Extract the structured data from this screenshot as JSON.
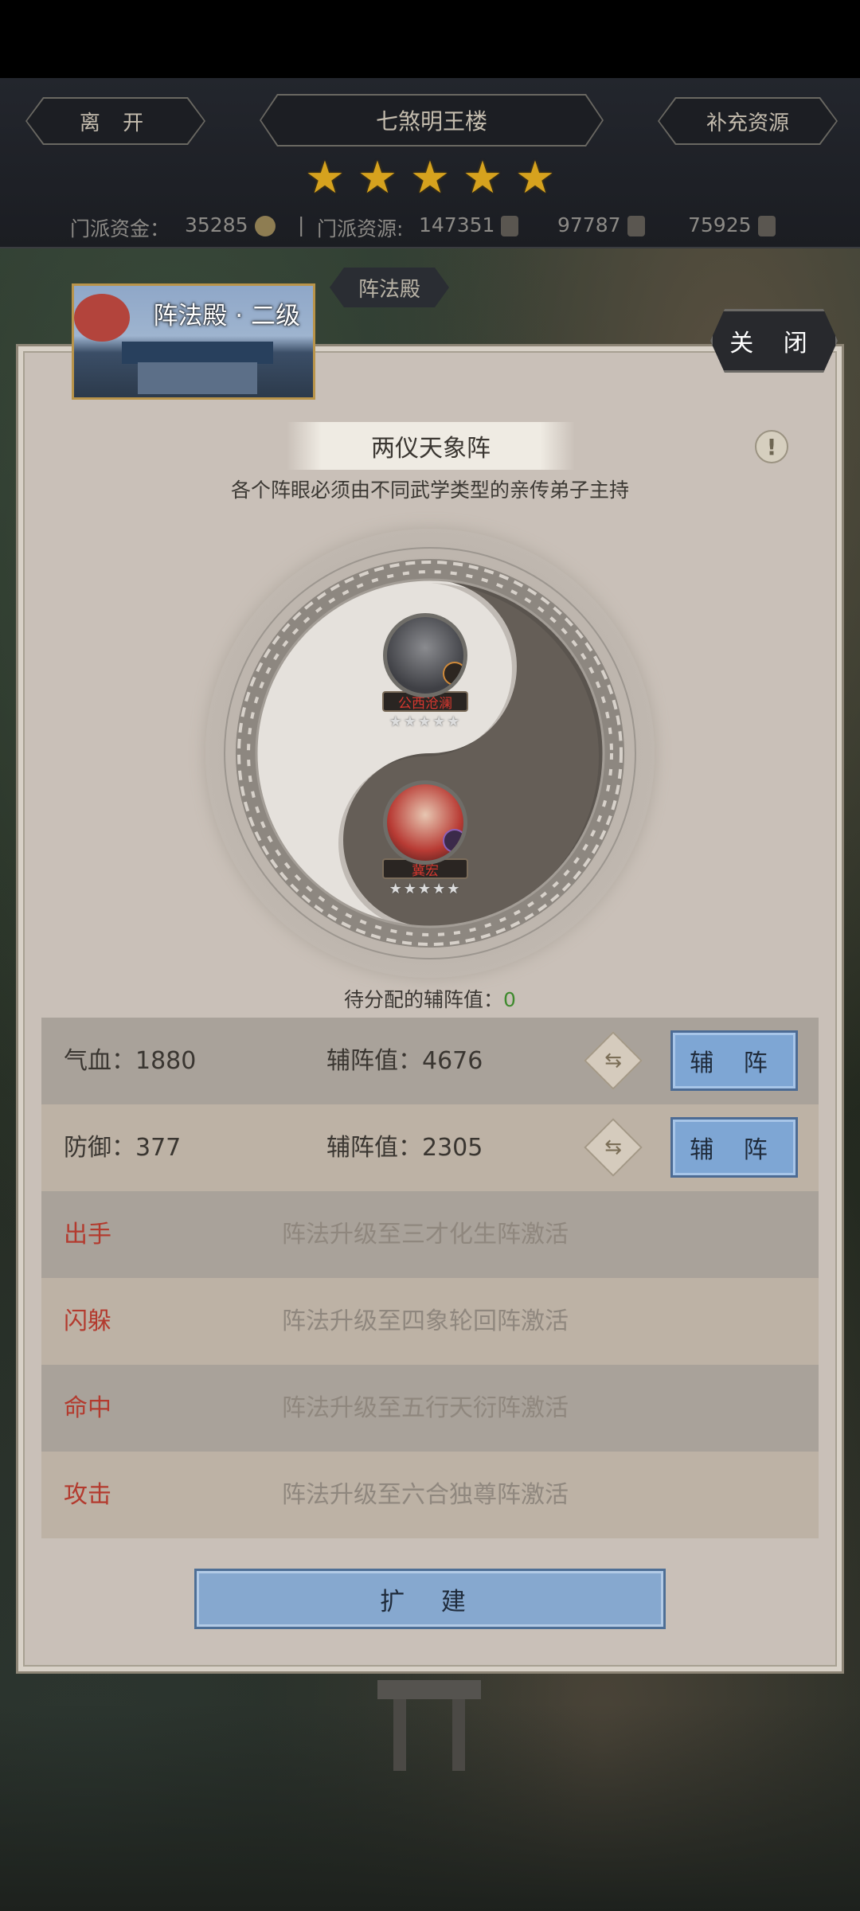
{
  "header": {
    "leave_label": "离 开",
    "location_title": "七煞明王楼",
    "replenish_label": "补充资源",
    "stars": [
      "★",
      "★",
      "★",
      "★",
      "★"
    ],
    "resources": {
      "funds_label": "门派资金：",
      "funds_value": "35285",
      "separator": "|",
      "resource_label": "门派资源:",
      "resource_value": "147351",
      "res2_value": "97787",
      "res3_value": "75925"
    }
  },
  "hall_tab": "阵法殿",
  "panel": {
    "thumb_title": "阵法殿 · 二级",
    "close_label": "关 闭",
    "formation_name": "两仪天象阵",
    "info_icon": "!",
    "description": "各个阵眼必须由不同武学类型的亲传弟子主持",
    "units": [
      {
        "name": "公西沧澜",
        "stars": "★★★★★"
      },
      {
        "name": "冀宏",
        "stars": "★★★★★"
      }
    ],
    "pending_label": "待分配的辅阵值：",
    "pending_value": "0",
    "stat_rows": [
      {
        "label": "气血：1880",
        "assist": "辅阵值：4676",
        "button": "辅 阵",
        "swap_icon": "⇆"
      },
      {
        "label": "防御：377",
        "assist": "辅阵值：2305",
        "button": "辅 阵",
        "swap_icon": "⇆"
      }
    ],
    "locked_rows": [
      {
        "label": "出手",
        "hint": "阵法升级至三才化生阵激活"
      },
      {
        "label": "闪躲",
        "hint": "阵法升级至四象轮回阵激活"
      },
      {
        "label": "命中",
        "hint": "阵法升级至五行天衍阵激活"
      },
      {
        "label": "攻击",
        "hint": "阵法升级至六合独尊阵激活"
      }
    ],
    "expand_label": "扩 建"
  },
  "colors": {
    "accent_blue": "#7ea6d4",
    "star_gold": "#d6a21e",
    "locked_red": "#b33a2e",
    "pending_green": "#3f8a2e"
  }
}
